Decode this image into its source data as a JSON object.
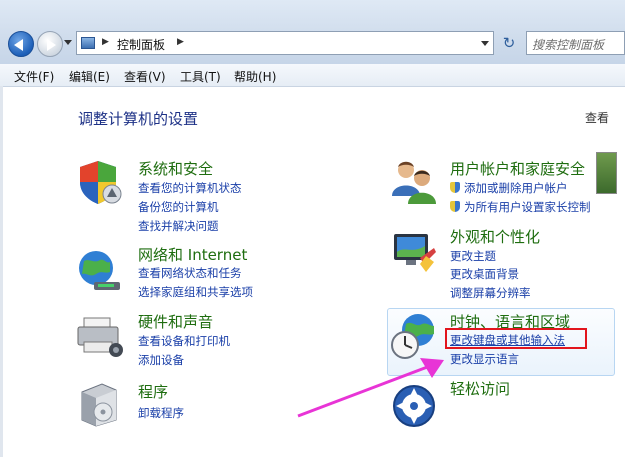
{
  "address_bar": {
    "path": "控制面板",
    "search_placeholder": "搜索控制面板"
  },
  "menu": {
    "items": [
      "文件(F)",
      "编辑(E)",
      "查看(V)",
      "工具(T)",
      "帮助(H)"
    ]
  },
  "page": {
    "title": "调整计算机的设置",
    "view_by": "查看"
  },
  "categories": {
    "system": {
      "title": "系统和安全",
      "links": [
        "查看您的计算机状态",
        "备份您的计算机",
        "查找并解决问题"
      ]
    },
    "network": {
      "title": "网络和 Internet",
      "links": [
        "查看网络状态和任务",
        "选择家庭组和共享选项"
      ]
    },
    "hardware": {
      "title": "硬件和声音",
      "links": [
        "查看设备和打印机",
        "添加设备"
      ]
    },
    "programs": {
      "title": "程序",
      "links": [
        "卸载程序"
      ]
    },
    "users": {
      "title": "用户帐户和家庭安全",
      "links": [
        "添加或删除用户帐户",
        "为所有用户设置家长控制"
      ]
    },
    "appearance": {
      "title": "外观和个性化",
      "links": [
        "更改主题",
        "更改桌面背景",
        "调整屏幕分辨率"
      ]
    },
    "clock": {
      "title": "时钟、语言和区域",
      "links": [
        "更改键盘或其他输入法",
        "更改显示语言"
      ]
    },
    "ease": {
      "title": "轻松访问"
    }
  },
  "colors": {
    "title_green": "#1e6d0f",
    "link_blue": "#1a3fa8",
    "highlight_red": "#e2151d",
    "annotation_arrow": "#e834d6"
  }
}
